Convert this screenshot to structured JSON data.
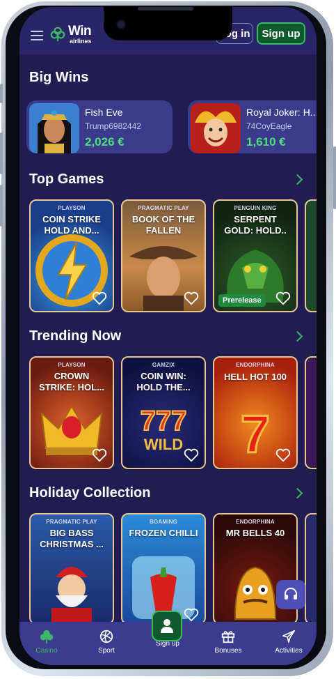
{
  "header": {
    "logo_text": "Win",
    "logo_sub": "airlines",
    "login_label": "Log in",
    "signup_label": "Sign up"
  },
  "big_wins": {
    "title": "Big Wins",
    "items": [
      {
        "game": "Fish Eve",
        "user": "Trump6982442",
        "amount": "2,026 €"
      },
      {
        "game": "Royal Joker: H...",
        "user": "74CoyEagle",
        "amount": "1,610 €"
      }
    ]
  },
  "top_games": {
    "title": "Top Games",
    "games": [
      {
        "provider": "PLAYSON",
        "title": "COIN STRIKE HOLD AND...",
        "badge": ""
      },
      {
        "provider": "PRAGMATIC PLAY",
        "title": "BOOK OF THE FALLEN",
        "badge": ""
      },
      {
        "provider": "PENGUIN KING",
        "title": "SERPENT GOLD: HOLD..",
        "badge": "Prerelease"
      }
    ]
  },
  "trending": {
    "title": "Trending Now",
    "games": [
      {
        "provider": "PLAYSON",
        "title": "CROWN STRIKE: HOL..."
      },
      {
        "provider": "GAMZIX",
        "title": "COIN WIN: HOLD THE..."
      },
      {
        "provider": "ENDORPHINA",
        "title": "HELL HOT 100"
      }
    ]
  },
  "holiday": {
    "title": "Holiday Collection",
    "games": [
      {
        "provider": "PRAGMATIC PLAY",
        "title": "BIG BASS CHRISTMAS ..."
      },
      {
        "provider": "BGAMING",
        "title": "FROZEN CHILLI"
      },
      {
        "provider": "ENDORPHINA",
        "title": "MR BELLS 40"
      }
    ]
  },
  "nav": {
    "casino": "Casino",
    "sport": "Sport",
    "signup": "Sign up",
    "bonuses": "Bonuses",
    "activities": "Activities"
  },
  "colors": {
    "background": "#211c52",
    "accent_green": "#3fb768",
    "win_amount": "#4fe07b",
    "card_border": "#e7c894"
  }
}
